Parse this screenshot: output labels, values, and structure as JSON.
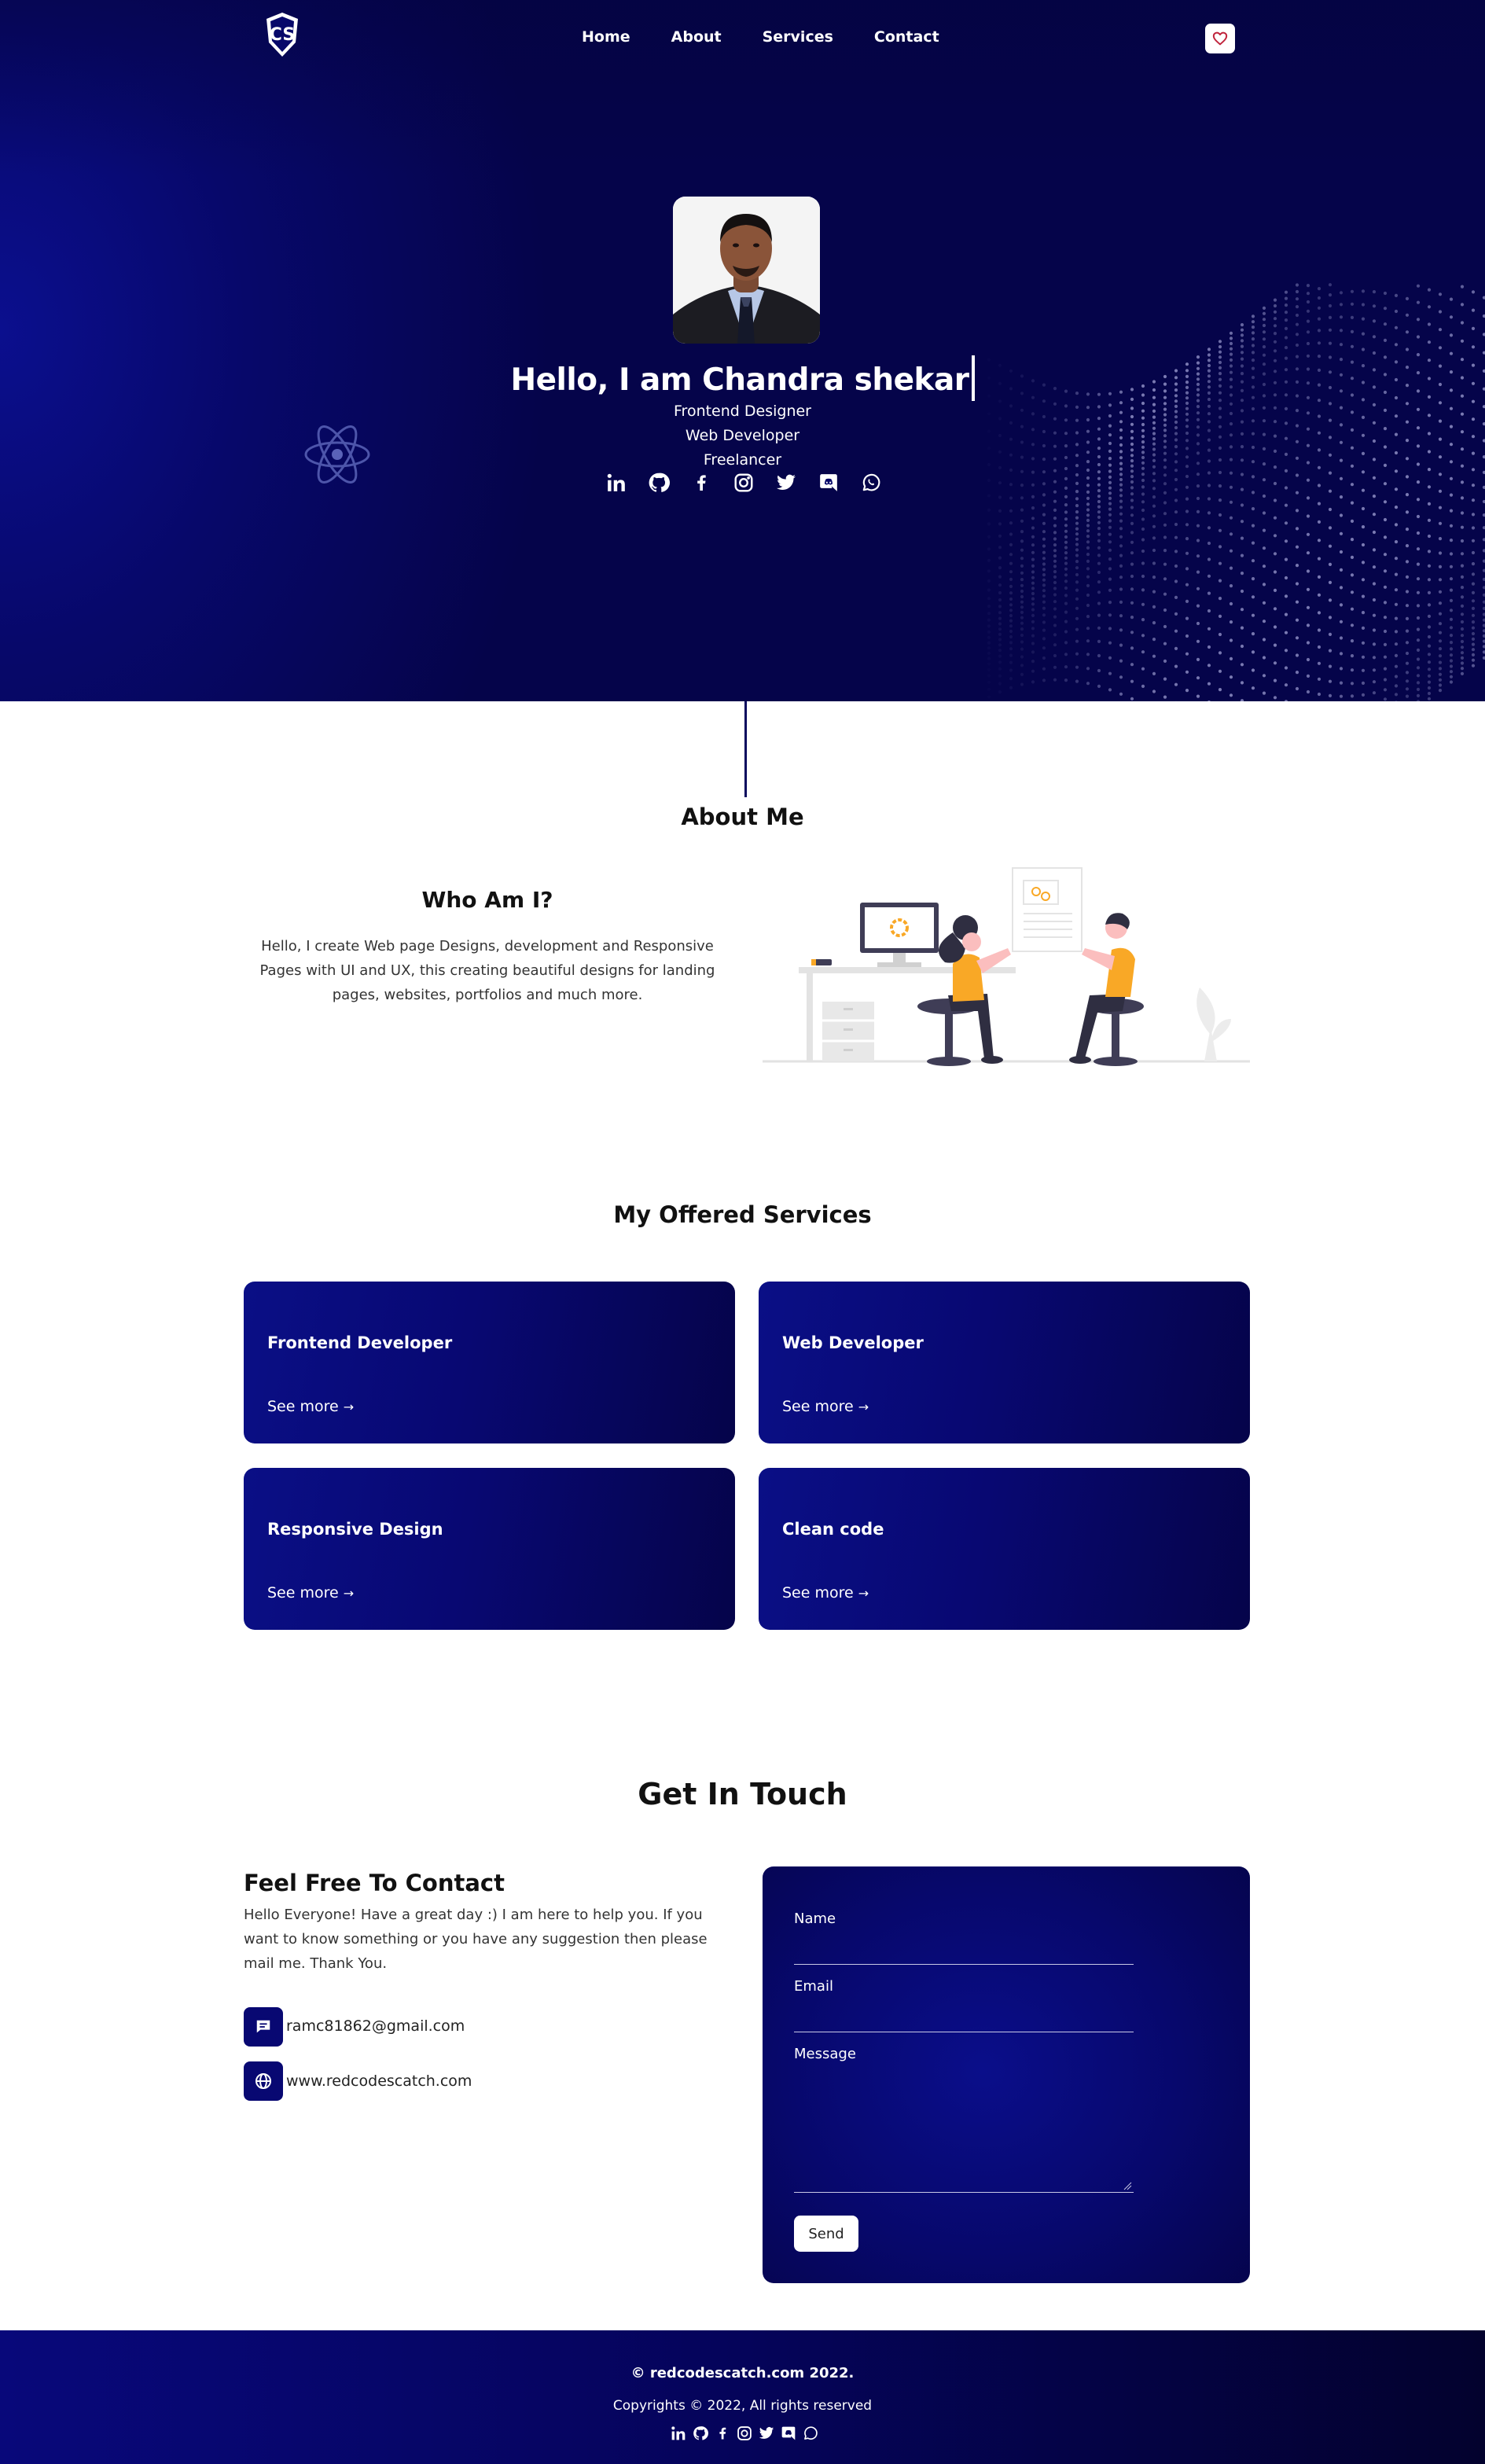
{
  "nav": {
    "links": [
      "Home",
      "About",
      "Services",
      "Contact"
    ],
    "favorite_icon": "heart-icon",
    "logo_icon": "cs-shield-logo"
  },
  "hero": {
    "title": "Hello, I am Chandra shekar",
    "roles": [
      "Frontend Designer",
      "Web Developer",
      "Freelancer"
    ],
    "social_icons": [
      "linkedin-icon",
      "github-icon",
      "facebook-icon",
      "instagram-icon",
      "twitter-icon",
      "discord-icon",
      "whatsapp-icon"
    ]
  },
  "about": {
    "heading": "About Me",
    "subheading": "Who Am I?",
    "text": "Hello, I create Web page Designs, development and Responsive Pages with UI and UX, this creating beautiful designs for landing pages, websites, portfolios and much more."
  },
  "services": {
    "heading": "My Offered Services",
    "items": [
      {
        "title": "Frontend Developer",
        "link": "See more"
      },
      {
        "title": "Web Developer",
        "link": "See more"
      },
      {
        "title": "Responsive Design",
        "link": "See more"
      },
      {
        "title": "Clean code",
        "link": "See more"
      }
    ]
  },
  "contact": {
    "heading": "Get In Touch",
    "subheading": "Feel Free To Contact",
    "text": "Hello Everyone! Have a great day :) I am here to help you. If you want to know something or you have any suggestion then please mail me. Thank You.",
    "email": "ramc81862@gmail.com",
    "website": "www.redcodescatch.com",
    "form": {
      "name_label": "Name",
      "email_label": "Email",
      "message_label": "Message",
      "send_label": "Send"
    }
  },
  "footer": {
    "site": "© redcodescatch.com 2022.",
    "copyright": "Copyrights © 2022, All rights reserved"
  },
  "colors": {
    "brand_navy": "#07086a",
    "accent_yellow": "#f9a826"
  }
}
